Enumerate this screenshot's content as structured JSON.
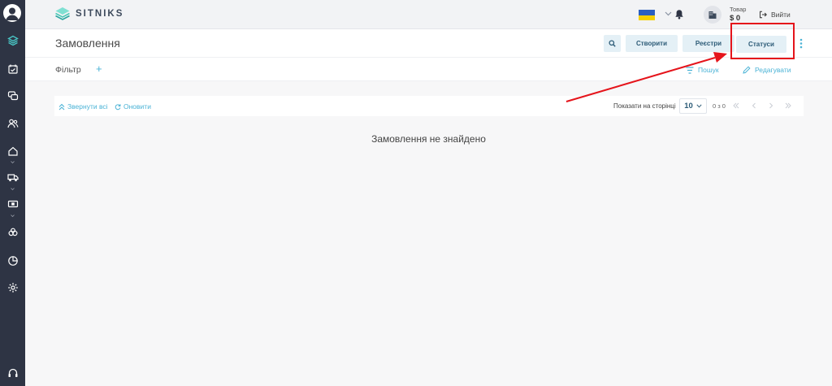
{
  "app": {
    "logo_text": "SITNIKS"
  },
  "topbar": {
    "product_label": "Товар",
    "product_amount": "$ 0",
    "logout_label": "Вийти"
  },
  "header": {
    "title": "Замовлення",
    "buttons": {
      "create": "Створити",
      "registers": "Реєстри",
      "statuses": "Статуси"
    }
  },
  "filter": {
    "label": "Фільтр",
    "add": "+",
    "search": "Пошук",
    "edit": "Редагувати"
  },
  "toolbar": {
    "collapse_all": "Звернути всі",
    "refresh": "Оновити",
    "per_page_label": "Показати на сторінці",
    "per_page_value": "10",
    "range": "0 з 0"
  },
  "empty_message": "Замовлення не знайдено",
  "colors": {
    "sidebar": "#2e3444",
    "accent": "#4bb3d6",
    "button_bg": "#e4f0f6",
    "button_text": "#2c5b77",
    "annotation": "#e5141b"
  },
  "icons": [
    "avatar-icon",
    "layers-icon",
    "calendar-icon",
    "chat-icon",
    "users-icon",
    "home-icon",
    "truck-icon",
    "cash-icon",
    "sync-icon",
    "pie-chart-icon",
    "gear-icon",
    "headset-icon",
    "bell-icon",
    "building-icon",
    "logout-icon",
    "search-icon",
    "kebab-icon",
    "filter-icon",
    "edit-icon",
    "chevrons-up-icon",
    "refresh-icon",
    "chevron-down-icon",
    "first-page-icon",
    "prev-page-icon",
    "next-page-icon",
    "last-page-icon"
  ]
}
